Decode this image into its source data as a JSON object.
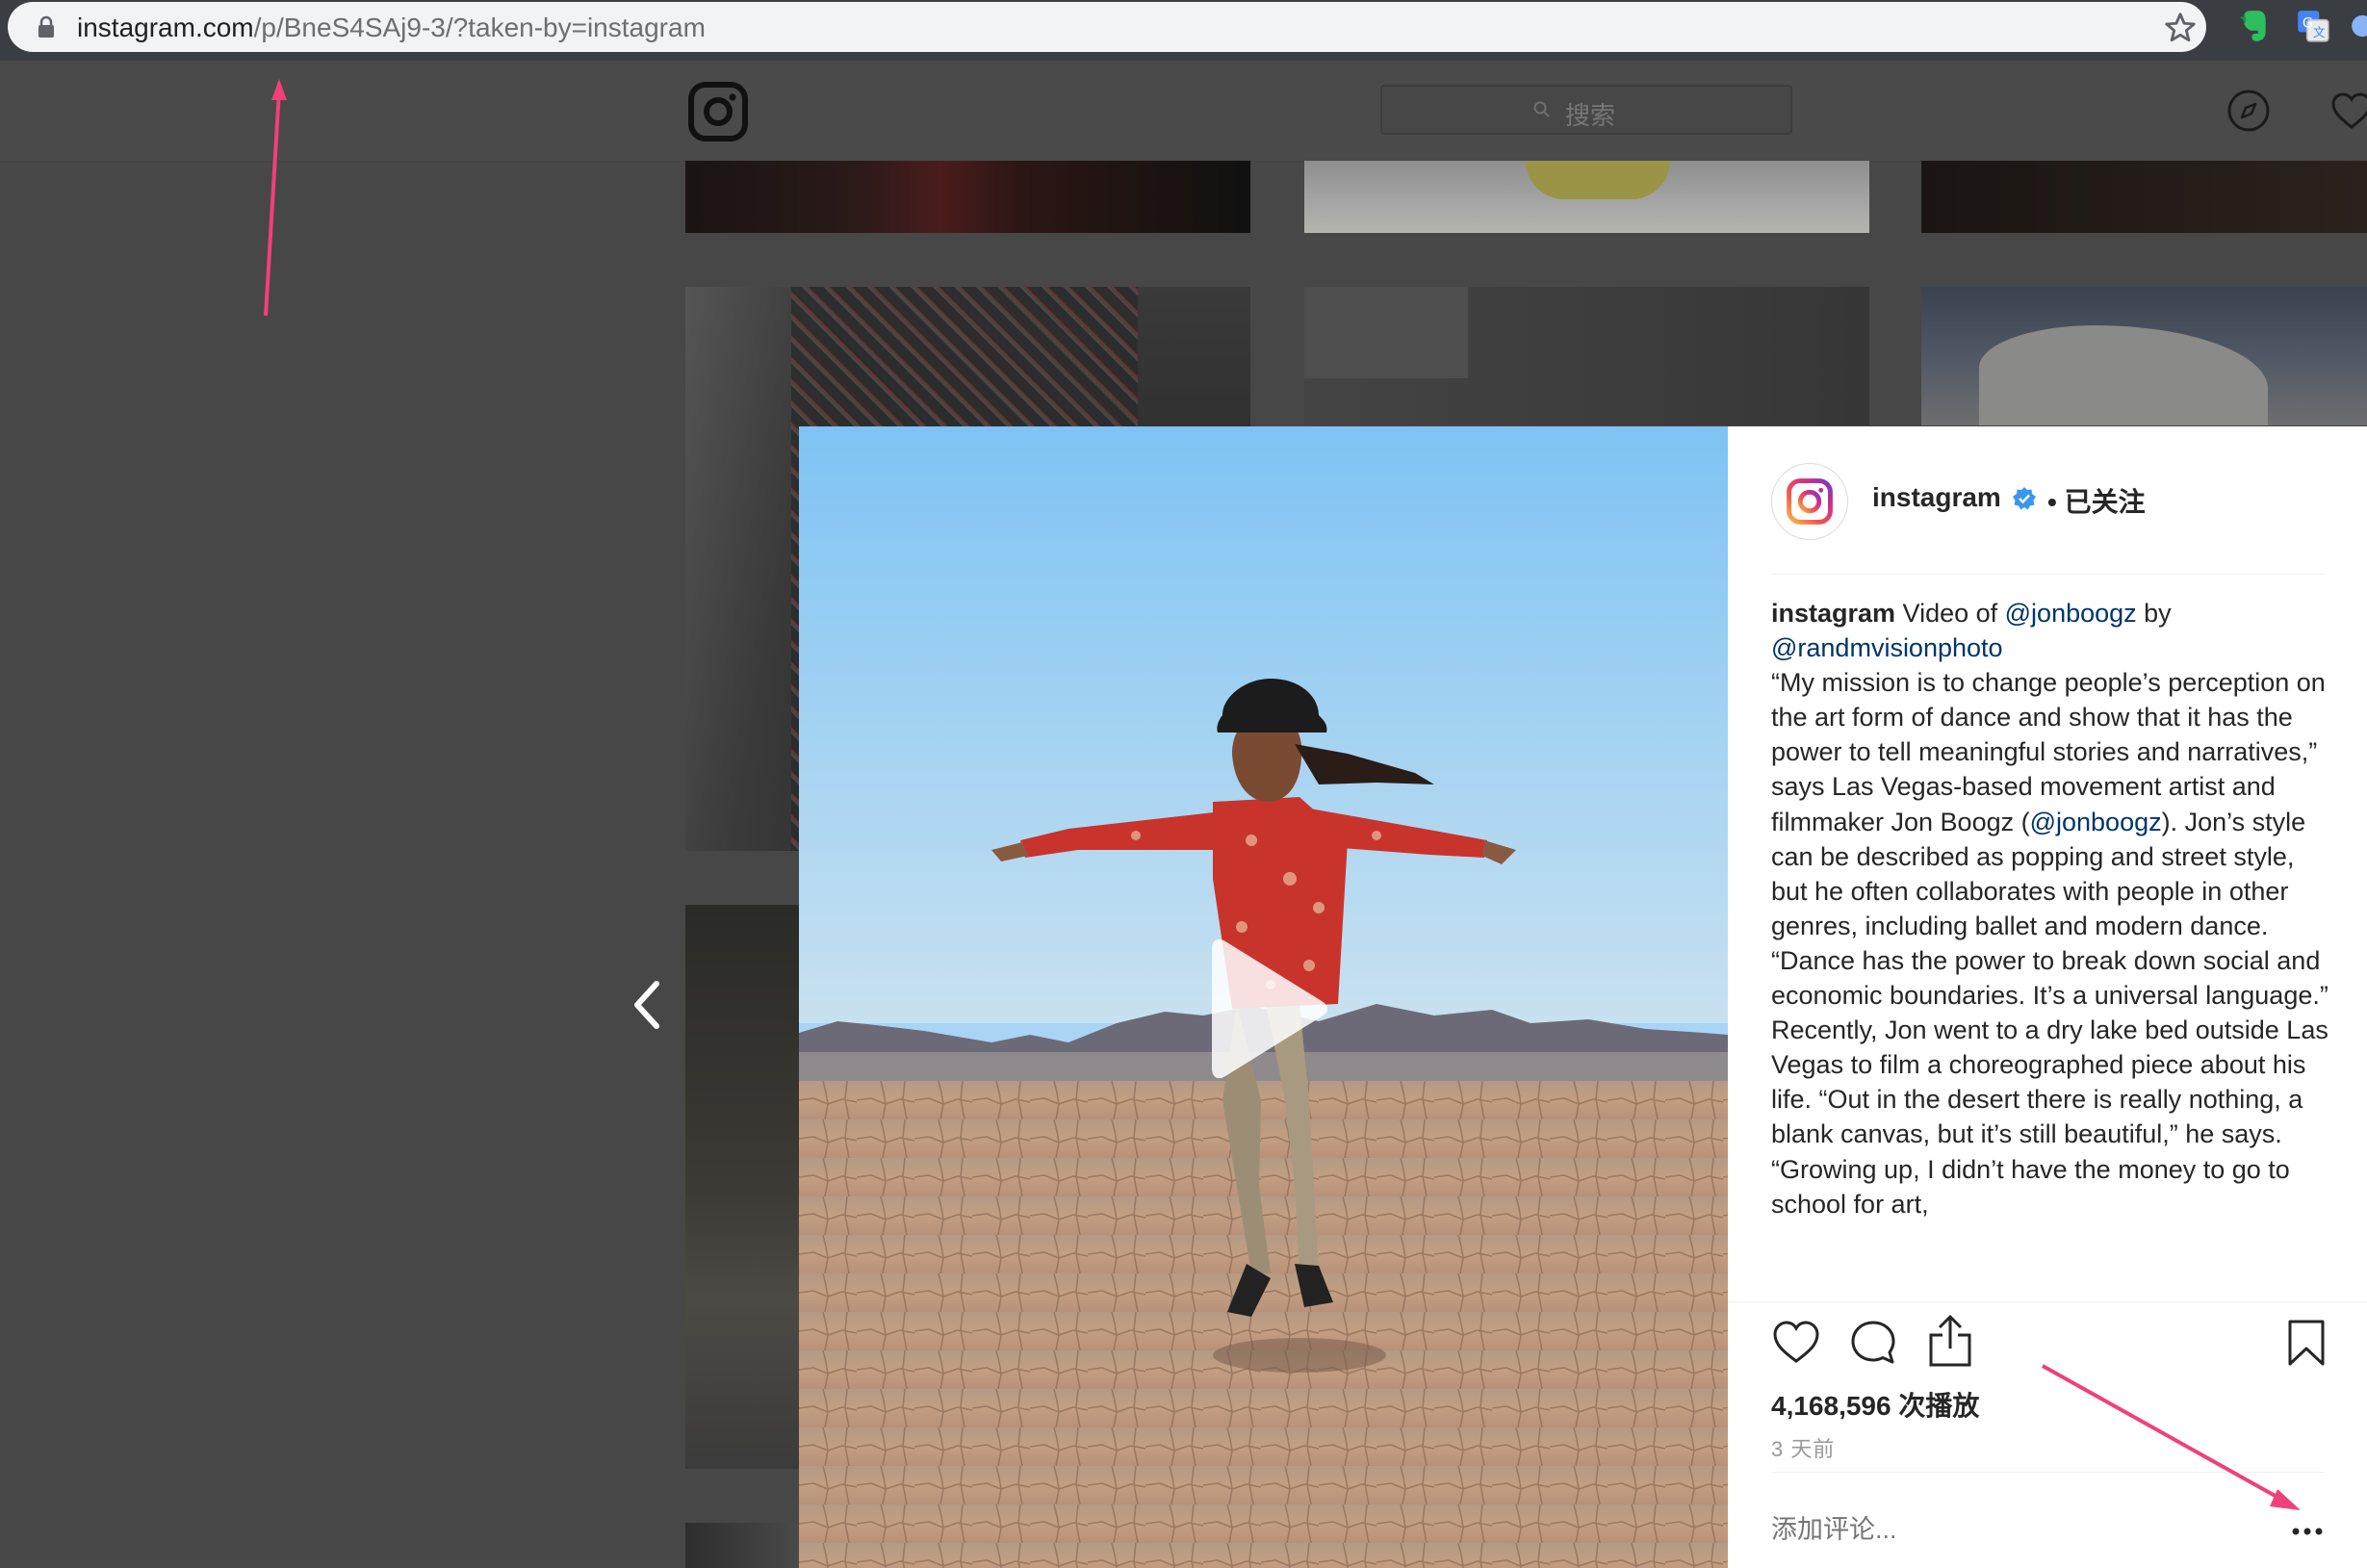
{
  "browser": {
    "url_domain": "instagram.com",
    "url_path": "/p/BneS4SAj9-3/?taken-by=instagram",
    "icons": [
      "lock-icon",
      "star-icon",
      "evernote-icon",
      "translate-icon"
    ]
  },
  "header": {
    "search_placeholder": "搜索",
    "icons": [
      "instagram-logo-icon",
      "search-icon",
      "compass-icon",
      "heart-icon"
    ]
  },
  "post": {
    "username": "instagram",
    "follow_status": "• 已关注",
    "caption": {
      "username": "instagram",
      "line1_a": " Video of ",
      "mention_1": "@jonboogz",
      "line1_b": " by",
      "mention_2": "@randmvisionphoto",
      "para1_a": "“My mission is to change people’s perception on the art form of dance and show that it has the power to tell meaningful stories and narratives,” says Las Vegas-based movement artist and filmmaker Jon Boogz (",
      "mention_3": "@jonboogz",
      "para1_b": "). Jon’s style can be described as popping and street style, but he often collaborates with people in other genres, including ballet and modern dance. “Dance has the power to break down social and economic boundaries. It’s a universal language.”",
      "para2": "Recently, Jon went to a dry lake bed outside Las Vegas to film a choreographed piece about his life. “Out in the desert there is really nothing, a blank canvas, but it’s still beautiful,” he says. “Growing up, I didn’t have the money to go to school for art,"
    },
    "views": "4,168,596 次播放",
    "time_ago": "3 天前",
    "comment_placeholder": "添加评论...",
    "more_options": "..."
  },
  "colors": {
    "annotation_arrow": "#f0407a",
    "mention": "#003569",
    "verified": "#3897f0"
  }
}
